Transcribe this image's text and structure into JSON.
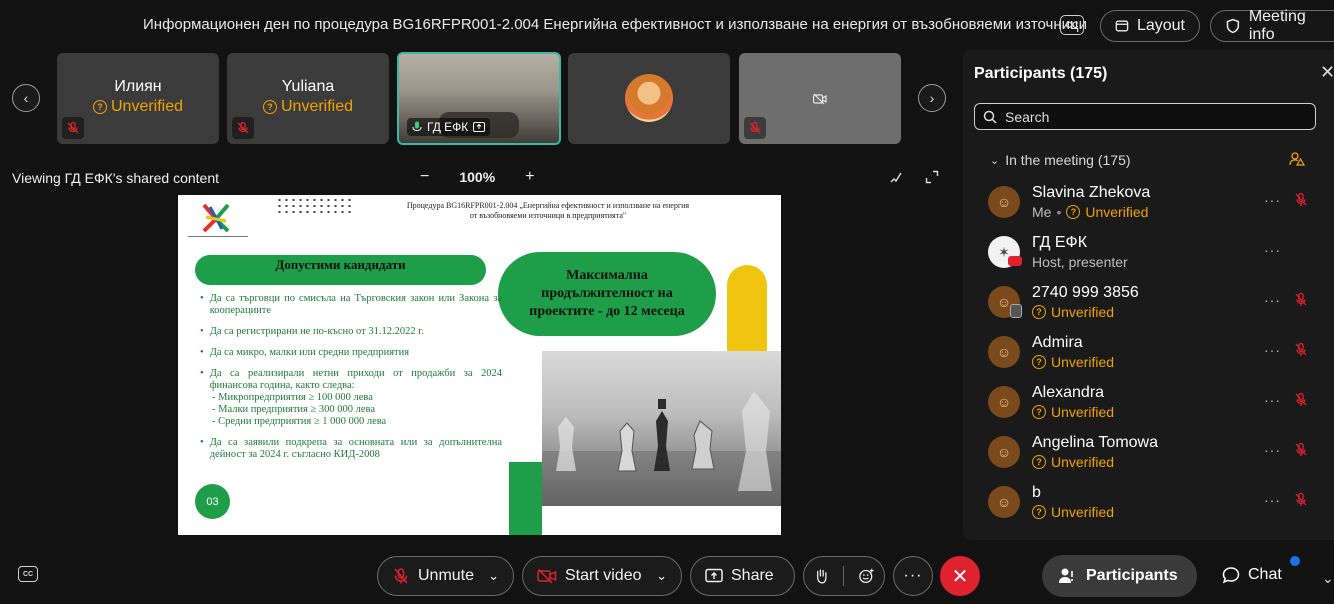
{
  "header": {
    "title": "Информационен ден по процедура BG16RFPR001-2.004 Енергийна ефективност и използване на енергия от възобновяеми източници",
    "cc_label": "CC",
    "layout_label": "Layout",
    "meeting_info_label": "Meeting info"
  },
  "thumbnails": [
    {
      "name": "Илиян",
      "status": "Unverified"
    },
    {
      "name": "Yuliana",
      "status": "Unverified"
    },
    {
      "name": "ГД ЕФК",
      "status": ""
    },
    {
      "name": "",
      "status": ""
    },
    {
      "name": "",
      "status": ""
    }
  ],
  "share": {
    "viewing_text": "Viewing ГД ЕФК's shared content",
    "zoom_minus": "−",
    "zoom_level": "100%",
    "zoom_plus": "+"
  },
  "slide": {
    "header_line1": "Процедура BG16RFPR001-2.004 „Енергийна ефективност и използване на енергия",
    "header_line2": "от възобновяеми източници в предприятията\"",
    "left_heading": "Допустими кандидати",
    "right_pill": "Максимална продължителност на проектите - до 12 месеца",
    "bullets": [
      "Да са търговци по смисъла на Търговския закон или Закона за кооперациите",
      "Да са регистрирани не по-късно от 31.12.2022 г.",
      "Да са микро, малки или средни предприятия",
      "Да са реализирали нетни приходи от продажби за 2024 финансова година, както следва:",
      "Да са заявили подкрепа за основната или за допълнителна дейност за 2024 г. съгласно КИД-2008"
    ],
    "sub_bullets": [
      "-  Микропредприятия ≥ 100 000 лева",
      "- Малки предприятия ≥ 300 000 лева",
      "- Средни предприятия ≥ 1 000 000 лева"
    ],
    "page_number": "03"
  },
  "panel": {
    "title": "Participants (175)",
    "search_placeholder": "Search",
    "group_label": "In the meeting (175)",
    "participants": [
      {
        "name": "Slavina Zhekova",
        "me": "Me",
        "status": "Unverified"
      },
      {
        "name": "ГД ЕФК",
        "role": "Host, presenter"
      },
      {
        "name": "2740 999 3856",
        "status": "Unverified"
      },
      {
        "name": "Admira",
        "status": "Unverified"
      },
      {
        "name": "Alexandra",
        "status": "Unverified"
      },
      {
        "name": "Angelina Tomowa",
        "status": "Unverified"
      },
      {
        "name": "b",
        "status": "Unverified"
      }
    ]
  },
  "controls": {
    "unmute_label": "Unmute",
    "start_video_label": "Start video",
    "share_label": "Share",
    "participants_label": "Participants",
    "chat_label": "Chat"
  },
  "colors": {
    "accent_green": "#1f9e49",
    "unverified_orange": "#f1a300",
    "leave_red": "#e0222f",
    "active_tile_border": "#3bb8a6"
  }
}
